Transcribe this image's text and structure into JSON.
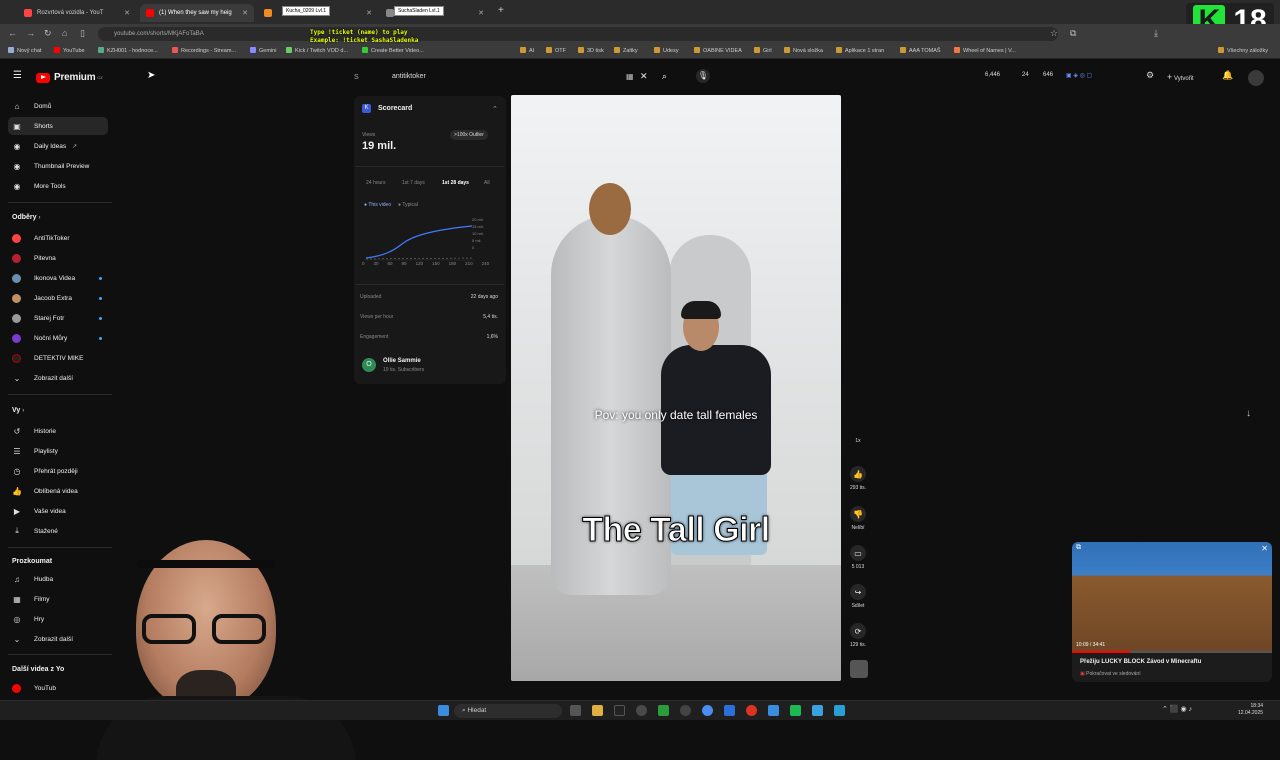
{
  "browser": {
    "tabs": [
      {
        "title": "Rozvrtová vozidla - YouT",
        "color": "#ff4444",
        "active": false
      },
      {
        "title": "(1) When they saw my heig",
        "color": "#ff0000",
        "active": true
      },
      {
        "title": "",
        "color": "#f08a24",
        "active": false
      },
      {
        "title": "",
        "color": "#888888",
        "active": false
      }
    ],
    "stream_overlays": [
      "Kucha_0209 Lvl.1",
      "SuchaSladen Lvl.1"
    ],
    "url": "youtube.com/shorts/MKjAFoTaBA",
    "chat_overlay_lines": [
      "Type !ticket (name) to play",
      "Example: !ticket SashaSladenka"
    ],
    "bookmarks": [
      "Nový chat",
      "YouTube",
      "KZH001 - hodnoce...",
      "Recordings - Stream...",
      "Gemini",
      "Kick / Twitch VOD d...",
      "Create Better Video...",
      "AI",
      "OTF",
      "3D tisk",
      "Zaltky",
      "Udesy",
      "OABINE VIDEA",
      "Girl",
      "Nová složka",
      "Aplikace 1 stran",
      "AAA TOMAŠ",
      "Wheel of Names | V...",
      "Všechny záložky"
    ],
    "badge": {
      "letter": "K",
      "number": "18"
    }
  },
  "youtube": {
    "logo_text": "Premium",
    "logo_region": "CZ",
    "search_query": "antitiktoker",
    "nav": [
      {
        "label": "Domů",
        "icon": "home-icon",
        "active": false
      },
      {
        "label": "Shorts",
        "icon": "shorts-icon",
        "active": true
      },
      {
        "label": "Daily Ideas",
        "icon": "ideas-icon",
        "active": false
      },
      {
        "label": "Thumbnail Preview",
        "icon": "preview-icon",
        "active": false
      },
      {
        "label": "More Tools",
        "icon": "tools-icon",
        "active": false
      }
    ],
    "subscriptions_header": "Odběry",
    "subscriptions": [
      {
        "label": "AntiTikToker",
        "color": "#ff4444",
        "dot": false
      },
      {
        "label": "Pitevna",
        "color": "#b81f2f",
        "dot": false
      },
      {
        "label": "Ikonova Videa",
        "color": "#6a8fb0",
        "dot": true
      },
      {
        "label": "Jacoob Extra",
        "color": "#c09060",
        "dot": true
      },
      {
        "label": "Starej Fotr",
        "color": "#9a9a9a",
        "dot": true
      },
      {
        "label": "Noční Můry",
        "color": "#7a3bd0",
        "dot": true
      },
      {
        "label": "DETEKTIV MIKE",
        "color": "#222222",
        "dot": false
      }
    ],
    "show_more_1": "Zobrazit další",
    "you_header": "Vy",
    "you_items": [
      "Historie",
      "Playlisty",
      "Přehrát později",
      "Oblíbená videa",
      "Vaše videa",
      "Stažené"
    ],
    "explore_header": "Prozkoumat",
    "explore_items": [
      "Hudba",
      "Filmy",
      "Hry"
    ],
    "show_more_2": "Zobrazit další",
    "more_header": "Další videa z Yo",
    "more_item": "YouTub",
    "top_right": {
      "stat_views": "6,446",
      "stat_a": "24",
      "stat_b": "646",
      "create_label": "Vytvořit"
    }
  },
  "scorecard": {
    "title": "Scorecard",
    "views_label": "Views",
    "views_value": "19 mil.",
    "outlier_badge": ">100x Outlier",
    "ranges": [
      "24 hours",
      "1st 7 days",
      "1st 28 days",
      "All"
    ],
    "active_range": "1st 28 days",
    "legend_this": "This video",
    "legend_typical": "Typical",
    "x_ticks": [
      "0",
      "30",
      "60",
      "90",
      "120",
      "150",
      "180",
      "210"
    ],
    "x_last": "240",
    "y_ticks": [
      "20 mil.",
      "15 mil.",
      "10 mil.",
      "5 mil.",
      "0"
    ],
    "uploaded_label": "Uploaded",
    "uploaded_value": "22 days ago",
    "vph_label": "Views per hour",
    "vph_value": "5,4 tis.",
    "engagement_label": "Engagement",
    "engagement_value": "1,6%",
    "channel_name": "Ollie Sammie",
    "channel_subs": "19 tis. Subscribers",
    "channel_initial": "O"
  },
  "short": {
    "caption_pov": "Pov: you only date tall females",
    "caption_big": "The Tall Girl",
    "speed": "1x",
    "likes": "293 tis.",
    "dislike_label": "Nelíbí",
    "comments": "5 013",
    "share_label": "Sdílet",
    "remix_count": "129 tis."
  },
  "miniplayer": {
    "time": "10:09 / 34:41",
    "title": "Přežiju LUCKY BLOCK Závod v Minecraftu",
    "subtitle": "Pokračovat ve sledování",
    "progress": 0.29
  },
  "taskbar": {
    "search_placeholder": "Hledat",
    "time": "18:34",
    "date": "12.04.2025"
  }
}
